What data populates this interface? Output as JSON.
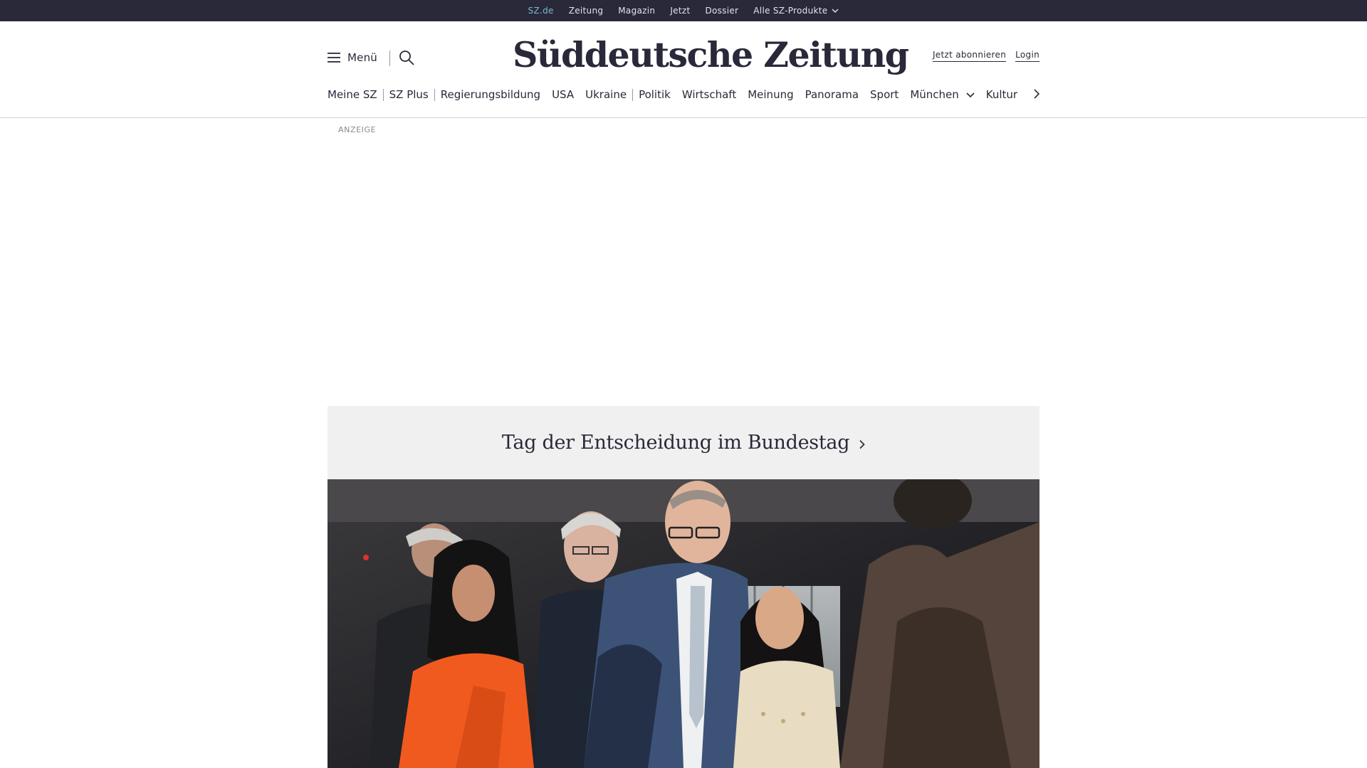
{
  "topbar": {
    "links": [
      "SZ.de",
      "Zeitung",
      "Magazin",
      "Jetzt",
      "Dossier",
      "Alle SZ-Produkte"
    ],
    "active": "SZ.de"
  },
  "header": {
    "menu_label": "Menü",
    "logo_text": "Süddeutsche Zeitung",
    "subscribe_label": "Jetzt abonnieren",
    "login_label": "Login"
  },
  "nav": {
    "items": [
      "Meine SZ",
      "SZ Plus",
      "Regierungsbildung",
      "USA",
      "Ukraine",
      "Politik",
      "Wirtschaft",
      "Meinung",
      "Panorama",
      "Sport",
      "München",
      "Kultur"
    ]
  },
  "ad": {
    "label": "ANZEIGE"
  },
  "topic": {
    "title": "Tag der Entscheidung im Bundestag"
  },
  "colors": {
    "topbar_bg": "#29293a",
    "active_link": "#7fb6cf",
    "banner_bg": "#f0f0f0",
    "text": "#29293a"
  },
  "icons": [
    "hamburger-icon",
    "search-icon",
    "chevron-down-icon",
    "chevron-right-icon"
  ]
}
